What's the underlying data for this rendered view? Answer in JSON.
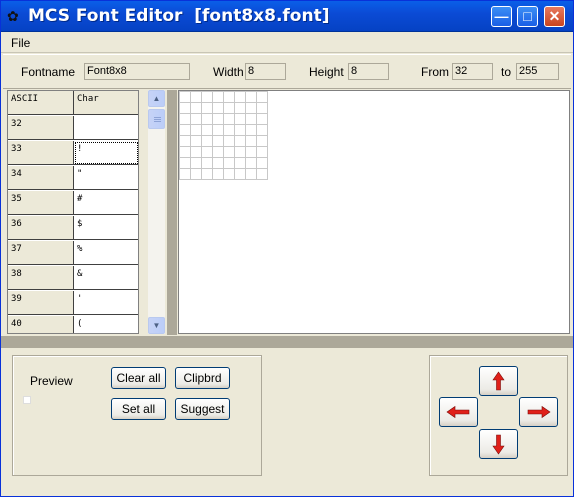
{
  "window": {
    "title": "MCS Font Editor  [font8x8.font]",
    "icon": "app-icon",
    "controls": [
      "minimize-icon",
      "maximize-icon",
      "close-icon"
    ]
  },
  "menu": {
    "file": "File"
  },
  "info": {
    "fontname_label": "Fontname",
    "fontname_value": "Font8x8",
    "width_label": "Width",
    "width_value": "8",
    "height_label": "Height",
    "height_value": "8",
    "from_label": "From",
    "from_value": "32",
    "to_label": "to",
    "to_value": "255"
  },
  "table": {
    "headers": [
      "ASCII",
      "Char"
    ],
    "rows": [
      {
        "ascii": "32",
        "char": ""
      },
      {
        "ascii": "33",
        "char": "!"
      },
      {
        "ascii": "34",
        "char": "\""
      },
      {
        "ascii": "35",
        "char": "#"
      },
      {
        "ascii": "36",
        "char": "$"
      },
      {
        "ascii": "37",
        "char": "%"
      },
      {
        "ascii": "38",
        "char": "&"
      },
      {
        "ascii": "39",
        "char": "'"
      },
      {
        "ascii": "40",
        "char": "("
      }
    ],
    "selected_ascii": "33"
  },
  "bottom": {
    "preview_label": "Preview",
    "clear_all": "Clear all",
    "clipbrd": "Clipbrd",
    "set_all": "Set all",
    "suggest": "Suggest"
  },
  "colors": {
    "arrow_red": "#e0201a",
    "title_blue": "#0a5fe8"
  }
}
